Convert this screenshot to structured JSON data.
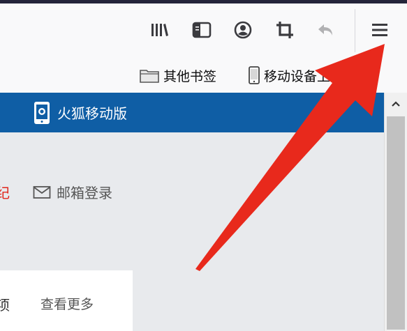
{
  "toolbar": {
    "icons": [
      "library-icon",
      "sidebar-icon",
      "account-icon",
      "screenshot-crop-icon",
      "undo-arrow-icon",
      "hamburger-menu-icon"
    ]
  },
  "bookmarks": {
    "other_bookmarks": "其他书签",
    "mobile_bookmarks": "移动设备上的书签"
  },
  "page": {
    "banner_label": "火狐移动版",
    "red_fragment": "纪",
    "mail_login": "邮箱登录",
    "card_fragment": "项",
    "see_more": "查看更多"
  },
  "colors": {
    "banner": "#0f5ea5",
    "annotation_arrow": "#e8291c"
  }
}
